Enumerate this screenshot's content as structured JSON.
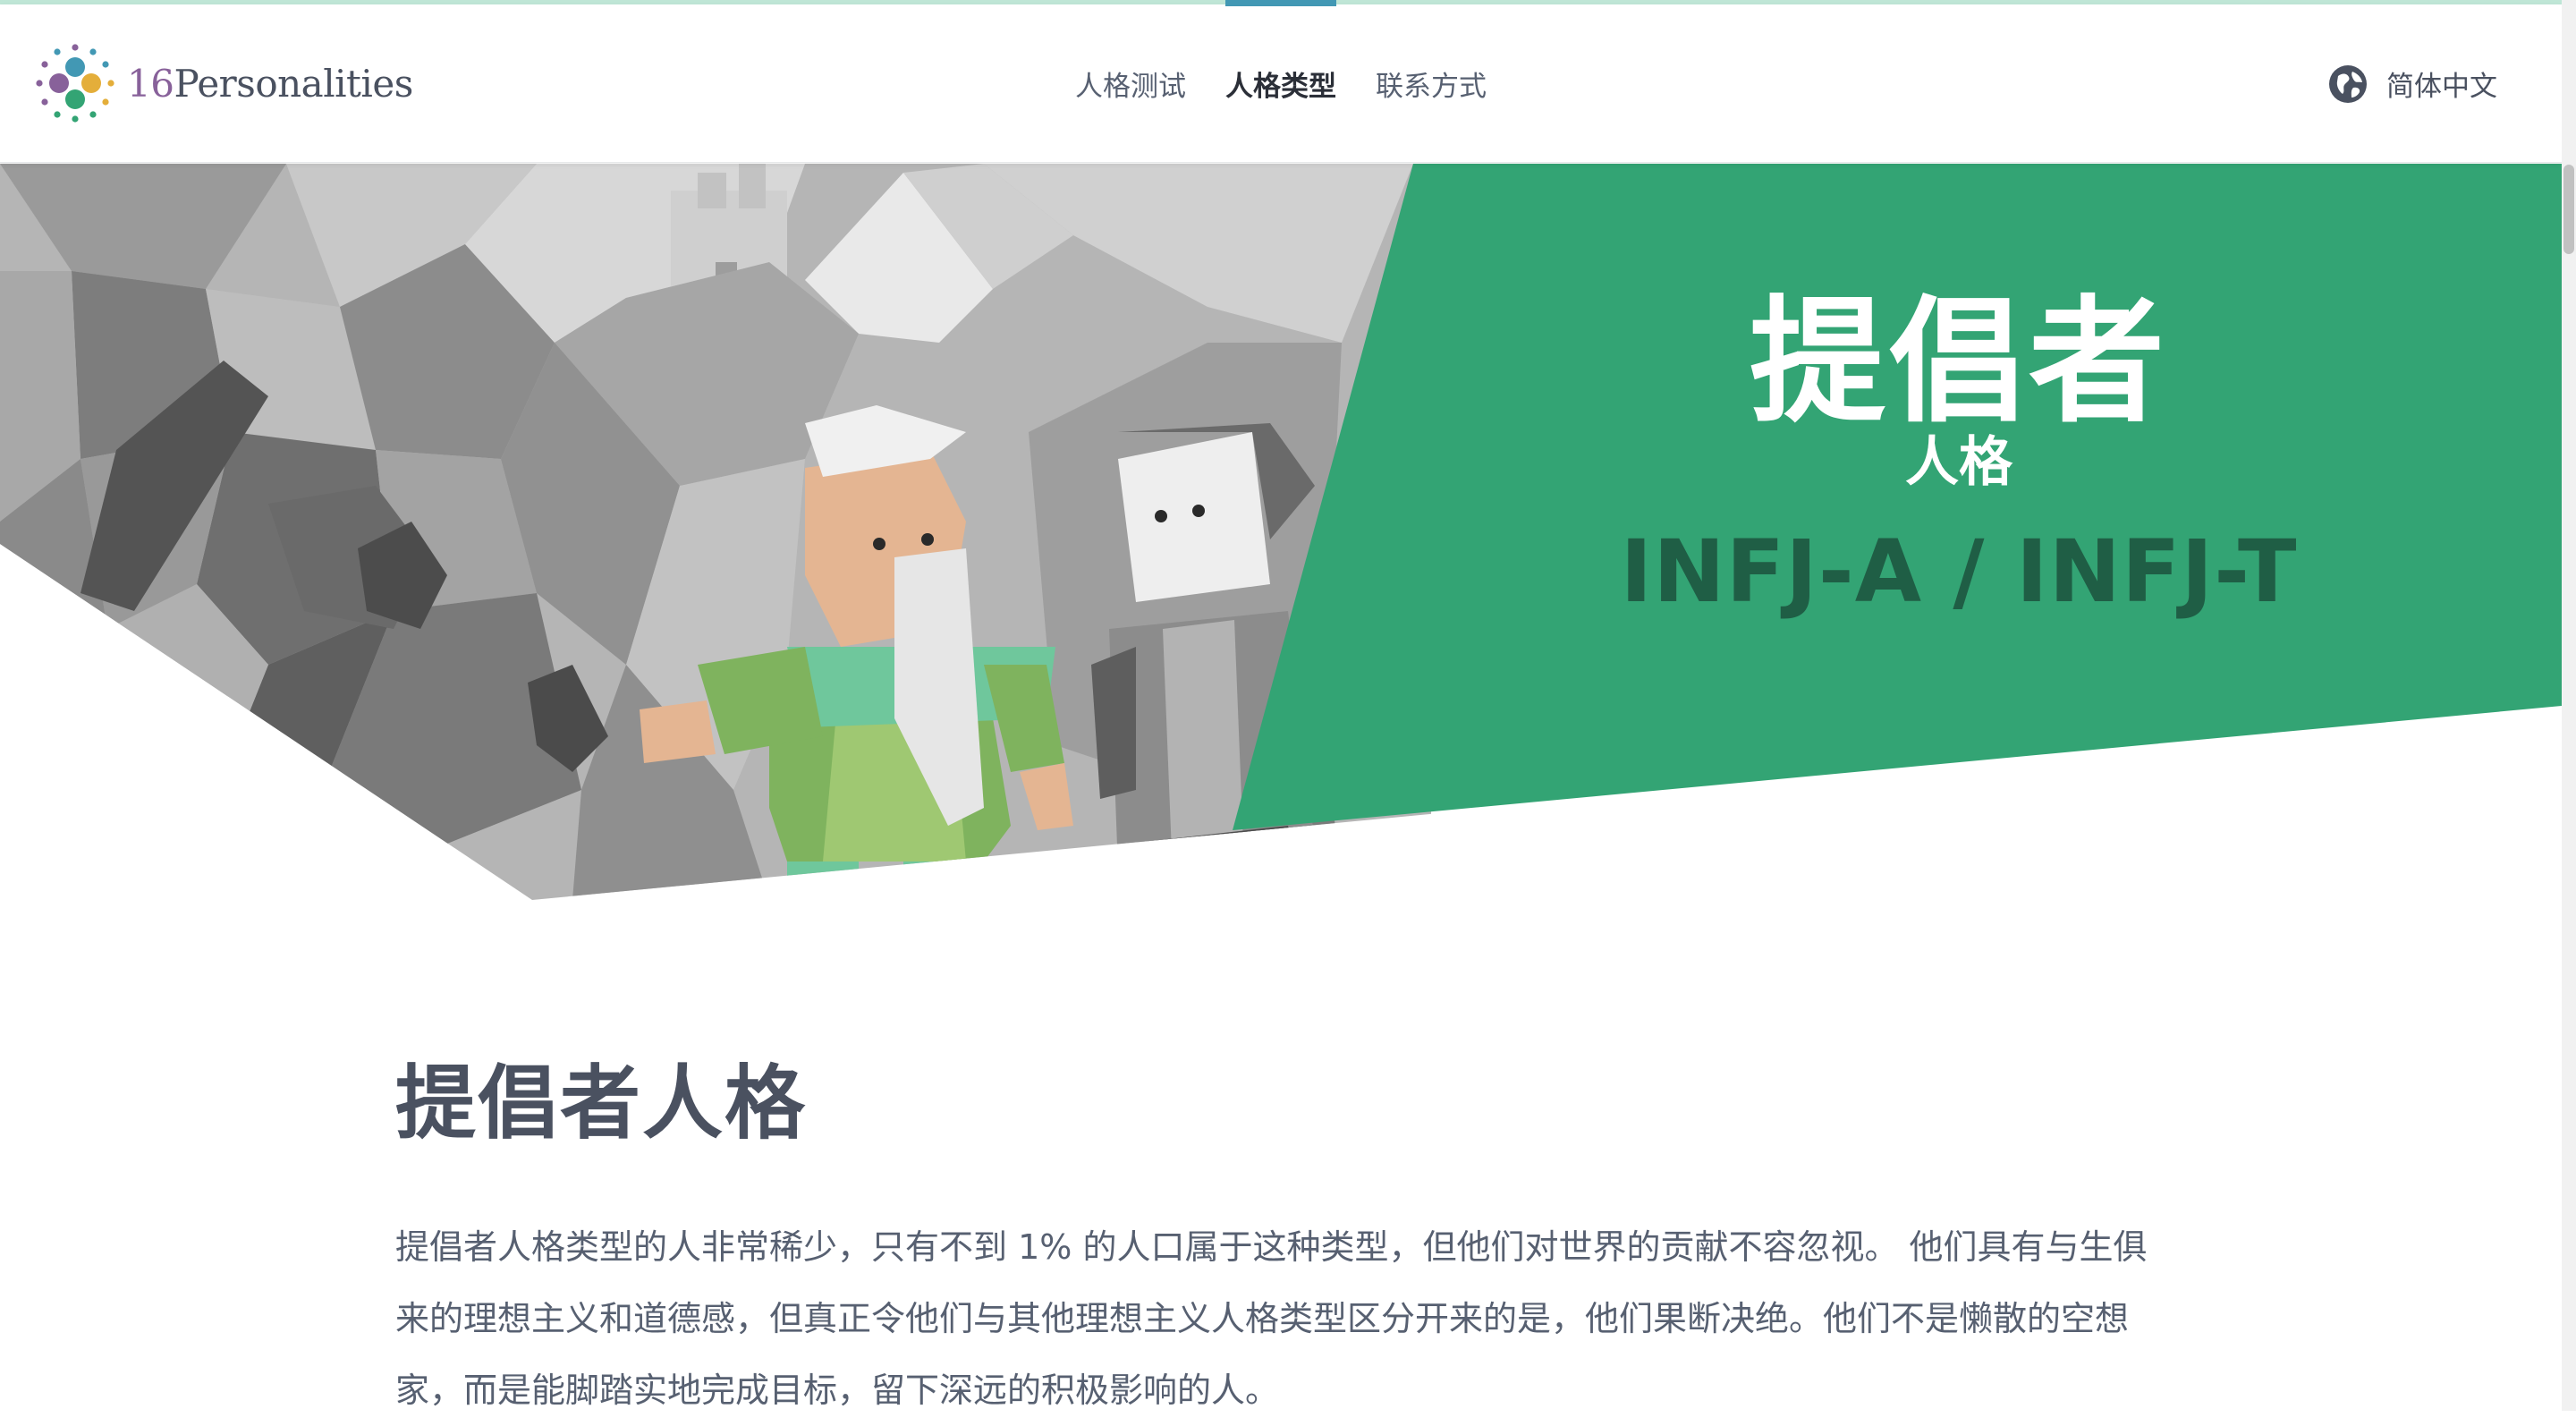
{
  "brand": {
    "number": "16",
    "name": "Personalities"
  },
  "nav": {
    "items": [
      {
        "label": "人格测试"
      },
      {
        "label": "人格类型"
      },
      {
        "label": "联系方式"
      }
    ],
    "active_index": 1
  },
  "language": {
    "label": "简体中文",
    "icon": "globe-icon"
  },
  "hero": {
    "title": "提倡者",
    "subtitle": "人格",
    "codes": "INFJ-A / INFJ-T",
    "accent_color": "#33a474",
    "code_color": "#1f5e45"
  },
  "article": {
    "heading": "提倡者人格",
    "paragraph": "提倡者人格类型的人非常稀少，只有不到 1% 的人口属于这种类型，但他们对世界的贡献不容忽视。 他们具有与生俱来的理想主义和道德感，但真正令他们与其他理想主义人格类型区分开来的是，他们果断决绝。他们不是懒散的空想家，而是能脚踏实地完成目标，留下深远的积极影响的人。"
  },
  "colors": {
    "logo_purple": "#88619a",
    "nav_active_underline": "#4298b4",
    "text_dark": "#4a5160"
  }
}
